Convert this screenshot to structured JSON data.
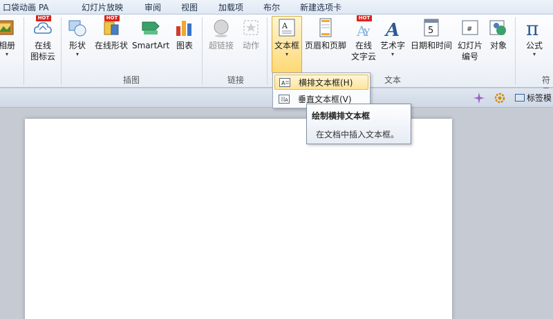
{
  "tabs": [
    "口袋动画 PA",
    "幻灯片放映",
    "审阅",
    "视图",
    "加载项",
    "布尔",
    "新建选项卡"
  ],
  "ribbon": {
    "album": {
      "label": "相册"
    },
    "online_icon_cloud": {
      "label1": "在线",
      "label2": "图标云"
    },
    "shape": {
      "label": "形状"
    },
    "online_shape": {
      "label": "在线形状"
    },
    "smartart": {
      "label": "SmartArt"
    },
    "chart": {
      "label": "图表"
    },
    "hyperlink": {
      "label": "超链接"
    },
    "action": {
      "label": "动作"
    },
    "textbox": {
      "label": "文本框"
    },
    "header_footer": {
      "label": "页眉和页脚"
    },
    "online_wordcloud": {
      "label1": "在线",
      "label2": "文字云"
    },
    "wordart": {
      "label": "艺术字"
    },
    "datetime": {
      "label": "日期和时间"
    },
    "slide_number": {
      "label1": "幻灯片",
      "label2": "编号"
    },
    "object": {
      "label": "对象"
    },
    "formula": {
      "label": "公式"
    },
    "symbol": {
      "label": "符号"
    },
    "hot_badge": "HOT",
    "groups": {
      "illustrations": "插图",
      "links": "链接",
      "text": "文本",
      "symbols": "符号"
    }
  },
  "dropdown": {
    "items": [
      {
        "label": "横排文本框(H)",
        "highlighted": true
      },
      {
        "label": "垂直文本框(V)",
        "highlighted": false
      }
    ]
  },
  "tooltip": {
    "title": "绘制横排文本框",
    "body": "在文档中插入文本框。"
  },
  "strip": {
    "label_template": "标签模"
  },
  "colors": {
    "accent": "#ffd86b",
    "hot": "#d8241e"
  }
}
